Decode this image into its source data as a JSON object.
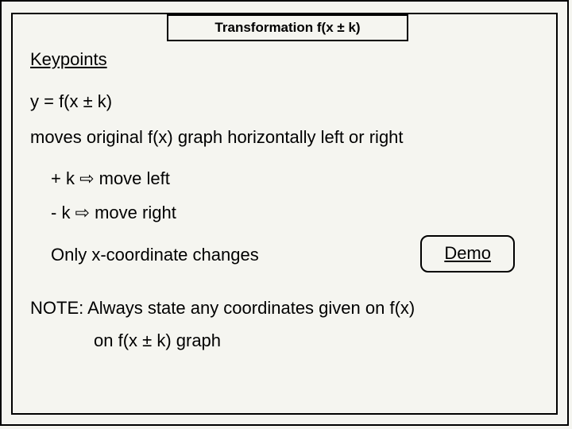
{
  "title": "Transformation f(x ± k)",
  "keypoints_label": "Keypoints",
  "equation": "y = f(x ± k)",
  "description": "moves original f(x) graph horizontally left or right",
  "rule_plus": "+ k ⇨ move left",
  "rule_minus": "- k ⇨ move right",
  "only_text": "Only  x-coordinate changes",
  "demo_label": "Demo",
  "note_line1": "NOTE: Always state any coordinates given on f(x)",
  "note_line2": "on f(x ± k) graph"
}
